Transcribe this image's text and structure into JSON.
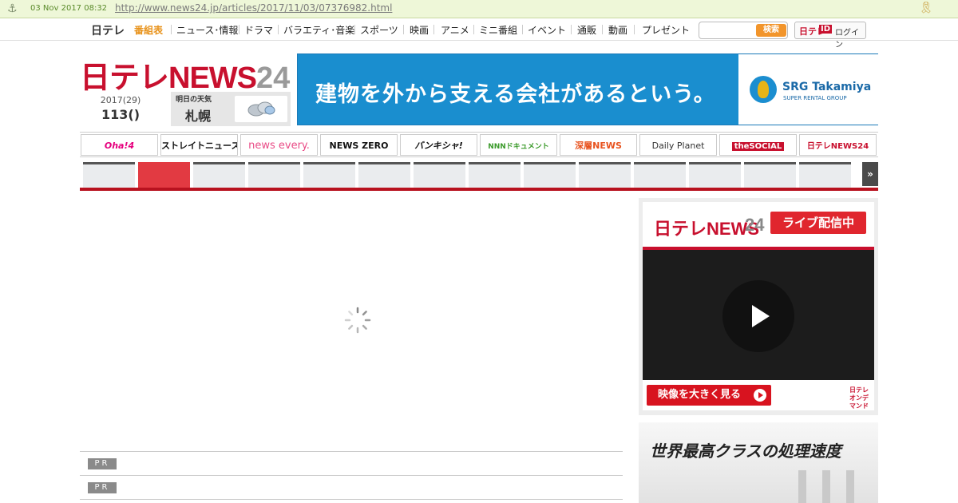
{
  "archive": {
    "date": "03 Nov 2017 08:32",
    "url": "http://www.news24.jp/articles/2017/11/03/07376982.html"
  },
  "topnav": {
    "logo": "日テレ",
    "items": [
      "番組表",
      "ニュース･情報",
      "ドラマ",
      "バラエティ･音楽",
      "スポーツ",
      "映画",
      "アニメ",
      "ミニ番組",
      "イベント",
      "通販",
      "動画",
      "プレゼント"
    ],
    "search_button": "検索",
    "login": {
      "ntv": "日テレ",
      "id": "ID",
      "label": "ログイン"
    }
  },
  "brand": {
    "part1": "日テレNEWS",
    "part2": "24"
  },
  "date": {
    "year": "2017(29)",
    "day": "113()"
  },
  "weather": {
    "label": "明日の天気",
    "city": "札幌",
    "icon": "cloud-icon"
  },
  "banner": {
    "text": "建物を外から支える会社があるという。",
    "advertiser": "SRG Takamiya",
    "advertiser_sub": "SUPER RENTAL GROUP"
  },
  "programs": [
    {
      "label": "Oha!4",
      "color": "#e6007e"
    },
    {
      "label": "ストレイトニュース",
      "color": "#111111"
    },
    {
      "label": "news every.",
      "color": "#e94b86"
    },
    {
      "label": "NEWS ZERO",
      "color": "#111111"
    },
    {
      "label": "バンキシャ!",
      "color": "#111111"
    },
    {
      "label": "NNNドキュメント",
      "color": "#3a9a2a"
    },
    {
      "label": "深層NEWS",
      "color": "#e8531f"
    },
    {
      "label": "Daily Planet",
      "color": "#333333"
    },
    {
      "label": "theSOCIAL",
      "color": "#c8102e"
    },
    {
      "label": "日テレNEWS24",
      "color": "#c8102e"
    }
  ],
  "pr": {
    "label": "PR"
  },
  "live": {
    "brand1": "日テレNEWS",
    "brand2": "24",
    "badge": "ライブ配信中",
    "button": "映像を大きく見る",
    "mini_logo": "日テレ オンデマンド"
  },
  "ad2": {
    "text": "世界最高クラスの処理速度"
  },
  "colors": {
    "brand_red": "#c8102e",
    "accent_orange": "#e8931c",
    "banner_blue": "#1a8ecf"
  }
}
